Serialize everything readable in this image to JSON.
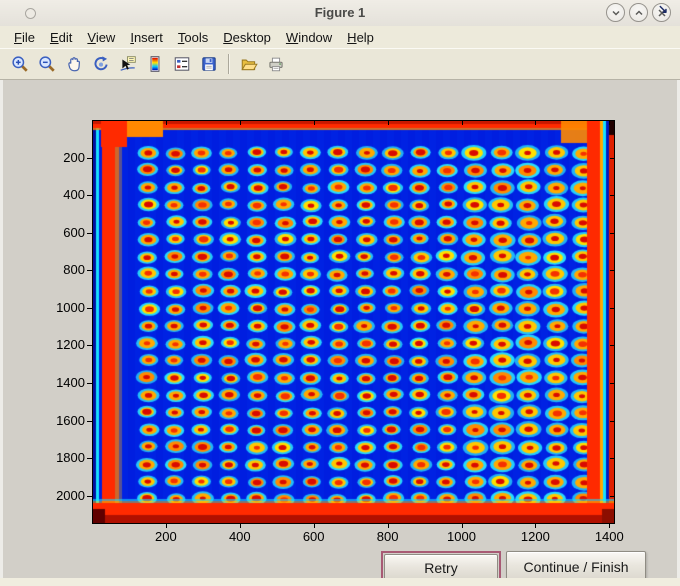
{
  "window": {
    "title": "Figure 1",
    "controls": [
      "shade",
      "unshade",
      "close"
    ]
  },
  "menubar": {
    "items": [
      "File",
      "Edit",
      "View",
      "Insert",
      "Tools",
      "Desktop",
      "Window",
      "Help"
    ],
    "dock_arrow": "↘"
  },
  "toolbar": {
    "buttons": [
      "zoom-in",
      "zoom-out",
      "pan",
      "rotate-3d",
      "data-cursor",
      "insert-colorbar",
      "insert-legend",
      "save-figure",
      "open-file",
      "print-figure"
    ]
  },
  "figure": {
    "buttons": {
      "retry": "Retry",
      "continue": "Continue / Finish"
    }
  },
  "chart_data": {
    "type": "heatmap",
    "title": "",
    "xlabel": "",
    "ylabel": "",
    "x_ticks": [
      200,
      400,
      600,
      800,
      1000,
      1200,
      1400
    ],
    "y_ticks": [
      200,
      400,
      600,
      800,
      1000,
      1200,
      1400,
      1600,
      1800,
      2000
    ],
    "x_range": [
      0,
      1410
    ],
    "y_range": [
      0,
      2140
    ],
    "y_direction": "down",
    "grid": "off",
    "colormap": "jet",
    "content": "Scanned microarray plate rendered in jet colormap: regular grid of assay spots (red cores, orange-yellow rings, cyan halos) on deep blue background; plate borders saturate to red/orange with cyan fringes",
    "spot_grid": {
      "cols": 17,
      "rows": 21,
      "first_center": [
        149,
        170
      ],
      "spacing": [
        74,
        92
      ]
    },
    "palette": {
      "background": "#001EE0",
      "halo": "#28E1FF",
      "ring": "#FFAA00",
      "ring_alt": "#FFC800",
      "core": "#D90A00",
      "edge_hot": "#FF2A00",
      "edge_warm": "#FF8800",
      "edge_dark": "#8C0E00",
      "stripe_cyan": "#18E0FF",
      "stripe_blue": "#0010A0"
    }
  }
}
